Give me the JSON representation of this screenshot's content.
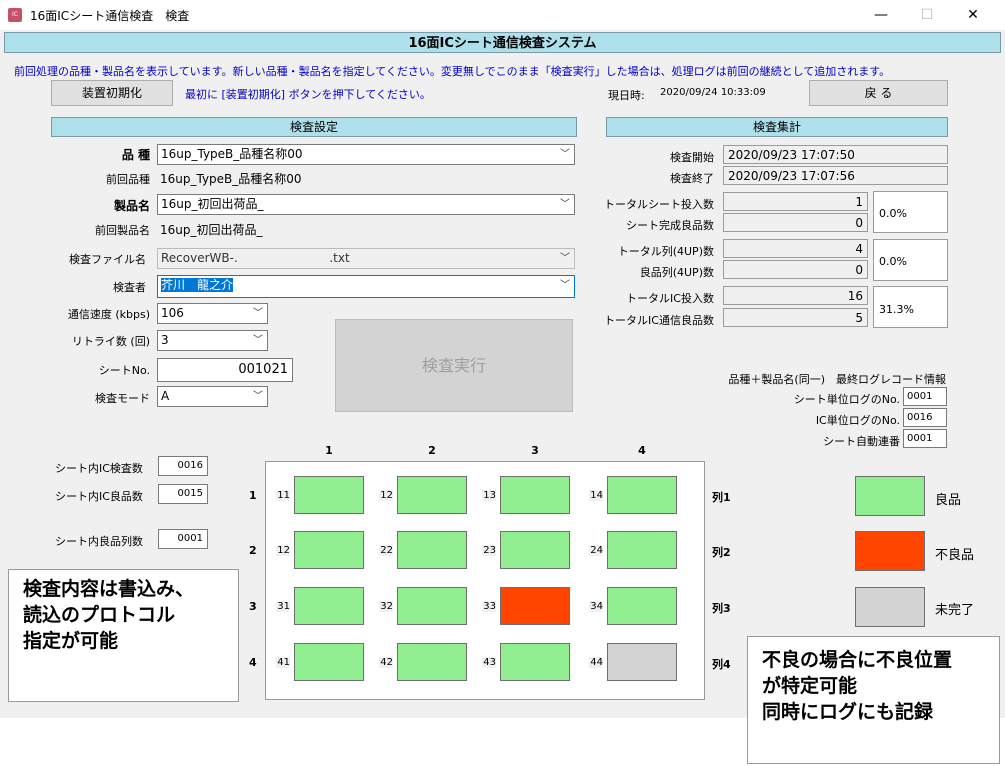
{
  "window": {
    "icon_text": "IC",
    "title": "16面ICシート通信検査　検査",
    "minimize": "—",
    "maximize": "☐",
    "close": "✕"
  },
  "header": {
    "system_title": "16面ICシート通信検査システム",
    "notice": "前回処理の品種・製品名を表示しています。新しい品種・製品名を指定してください。変更無しでこのまま「検査実行」した場合は、処理ログは前回の継続として追加されます。"
  },
  "toolbar": {
    "init_button": "装置初期化",
    "init_hint": "最初に [装置初期化] ボタンを押下してください。",
    "datetime_label": "現日時:",
    "datetime_value": "2020/09/24 10:33:09",
    "back_button": "戻 る"
  },
  "settings": {
    "header": "検査設定",
    "kind_label": "品 種",
    "kind_value": "16up_TypeB_品種名称00",
    "prev_kind_label": "前回品種",
    "prev_kind_value": "16up_TypeB_品種名称00",
    "product_label": "製品名",
    "product_value": "16up_初回出荷品_",
    "prev_product_label": "前回製品名",
    "prev_product_value": "16up_初回出荷品_",
    "file_label": "検査ファイル名",
    "file_value": "RecoverWB-.                        .txt",
    "inspector_label": "検査者",
    "inspector_value": "芥川　龍之介",
    "speed_label": "通信速度 (kbps)",
    "speed_value": "106",
    "retry_label": "リトライ数 (回)",
    "retry_value": "3",
    "sheet_no_label": "シートNo.",
    "sheet_no_value": "001021",
    "mode_label": "検査モード",
    "mode_value": "A",
    "run_button": "検査実行"
  },
  "summary": {
    "header": "検査集計",
    "start_label": "検査開始",
    "start_value": "2020/09/23 17:07:50",
    "end_label": "検査終了",
    "end_value": "2020/09/23 17:07:56",
    "total_sheets_label": "トータルシート投入数",
    "total_sheets_value": "1",
    "good_sheets_label": "シート完成良品数",
    "good_sheets_value": "0",
    "sheet_pct": "0.0%",
    "total_cols_label": "トータル列(4UP)数",
    "total_cols_value": "4",
    "good_cols_label": "良品列(4UP)数",
    "good_cols_value": "0",
    "col_pct": "0.0%",
    "total_ic_label": "トータルIC投入数",
    "total_ic_value": "16",
    "good_ic_label": "トータルIC通信良品数",
    "good_ic_value": "5",
    "ic_pct": "31.3%"
  },
  "log_info": {
    "title": "品種＋製品名(同一)　最終ログレコード情報",
    "sheet_log_label": "シート単位ログのNo.",
    "sheet_log_value": "0001",
    "ic_log_label": "IC単位ログのNo.",
    "ic_log_value": "0016",
    "sheet_seq_label": "シート自動連番",
    "sheet_seq_value": "0001"
  },
  "sheet_counts": {
    "ic_inspect_label": "シート内IC検査数",
    "ic_inspect_value": "0016",
    "ic_good_label": "シート内IC良品数",
    "ic_good_value": "0015",
    "good_cols_label": "シート内良品列数",
    "good_cols_value": "0001"
  },
  "grid": {
    "col_headers": [
      "1",
      "2",
      "3",
      "4"
    ],
    "row_headers": [
      "1",
      "2",
      "3",
      "4"
    ],
    "col_labels": [
      "列1",
      "列2",
      "列3",
      "列4"
    ],
    "rows": [
      [
        {
          "num": "11",
          "status": "good"
        },
        {
          "num": "12",
          "status": "good"
        },
        {
          "num": "13",
          "status": "good"
        },
        {
          "num": "14",
          "status": "good"
        }
      ],
      [
        {
          "num": "12",
          "status": "good"
        },
        {
          "num": "22",
          "status": "good"
        },
        {
          "num": "23",
          "status": "good"
        },
        {
          "num": "24",
          "status": "good"
        }
      ],
      [
        {
          "num": "31",
          "status": "good"
        },
        {
          "num": "32",
          "status": "good"
        },
        {
          "num": "33",
          "status": "bad"
        },
        {
          "num": "34",
          "status": "good"
        }
      ],
      [
        {
          "num": "41",
          "status": "good"
        },
        {
          "num": "42",
          "status": "good"
        },
        {
          "num": "43",
          "status": "good"
        },
        {
          "num": "44",
          "status": "pending"
        }
      ]
    ]
  },
  "legend": {
    "good_label": "良品",
    "bad_label": "不良品",
    "pending_label": "未完了"
  },
  "colors": {
    "good": "#90ee90",
    "bad": "#ff4500",
    "pending": "#d3d3d3"
  },
  "callouts": {
    "left_lines": [
      "検査内容は書込み、",
      "読込のプロトコル",
      "指定が可能"
    ],
    "right_lines": [
      "不良の場合に不良位置",
      "が特定可能",
      "同時にログにも記録"
    ]
  }
}
